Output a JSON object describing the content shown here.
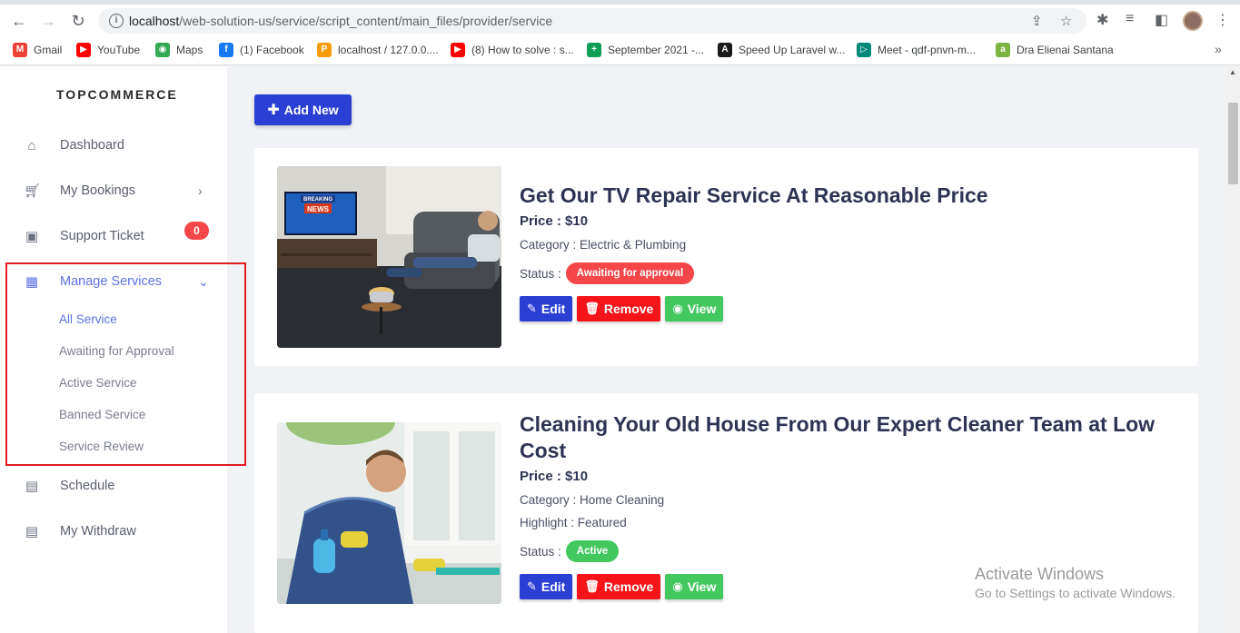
{
  "browser": {
    "url_host": "localhost",
    "url_path": "/web-solution-us/service/script_content/main_files/provider/service",
    "bookmarks": [
      {
        "label": "Gmail",
        "icon": "gmail-icon",
        "color": "#ea4335",
        "glyph": "M"
      },
      {
        "label": "YouTube",
        "icon": "youtube-icon",
        "color": "#ff0000",
        "glyph": "▶"
      },
      {
        "label": "Maps",
        "icon": "maps-icon",
        "color": "#34a853",
        "glyph": "◉"
      },
      {
        "label": "(1) Facebook",
        "icon": "facebook-icon",
        "color": "#1877f2",
        "glyph": "f"
      },
      {
        "label": "localhost / 127.0.0....",
        "icon": "phpmyadmin-icon",
        "color": "#f89c0e",
        "glyph": "P"
      },
      {
        "label": "(8) How to solve : s...",
        "icon": "youtube-icon",
        "color": "#ff0000",
        "glyph": "▶"
      },
      {
        "label": "September 2021 -...",
        "icon": "sheets-icon",
        "color": "#0f9d58",
        "glyph": "+"
      },
      {
        "label": "Speed Up Laravel w...",
        "icon": "laravel-icon",
        "color": "#1a1a1a",
        "glyph": "A"
      },
      {
        "label": "Meet - qdf-pnvn-m...",
        "icon": "meet-icon",
        "color": "#00897b",
        "glyph": "▷"
      },
      {
        "label": "Dra Elienai Santana",
        "icon": "site-icon",
        "color": "#7cb342",
        "glyph": "a"
      }
    ]
  },
  "sidebar": {
    "brand": "TOPCOMMERCE",
    "items": [
      {
        "label": "Dashboard",
        "icon": "home-icon"
      },
      {
        "label": "My Bookings",
        "icon": "cart-icon"
      },
      {
        "label": "Support Ticket",
        "icon": "ticket-icon",
        "badge": "0"
      },
      {
        "label": "Manage Services",
        "icon": "grid-icon"
      },
      {
        "label": "Schedule",
        "icon": "calendar-icon"
      },
      {
        "label": "My Withdraw",
        "icon": "wallet-icon"
      }
    ],
    "submenu": [
      "All Service",
      "Awaiting for Approval",
      "Active Service",
      "Banned Service",
      "Service Review"
    ]
  },
  "main": {
    "add_new": "Add New",
    "cards": [
      {
        "title": "Get Our TV Repair Service At Reasonable Price",
        "price": "Price : $10",
        "category": "Category : Electric & Plumbing",
        "status_label": "Status :",
        "status": "Awaiting for approval",
        "status_color": "#f5474a",
        "tv_text_1": "BREAKING",
        "tv_text_2": "NEWS"
      },
      {
        "title": "Cleaning Your Old House From Our Expert Cleaner Team at Low Cost",
        "price": "Price : $10",
        "category": "Category : Home Cleaning",
        "highlight": "Highlight : Featured",
        "status_label": "Status :",
        "status": "Active",
        "status_color": "#43c75f"
      }
    ],
    "actions": {
      "edit": "Edit",
      "remove": "Remove",
      "view": "View"
    }
  },
  "watermark": {
    "line1": "Activate Windows",
    "line2": "Go to Settings to activate Windows."
  }
}
